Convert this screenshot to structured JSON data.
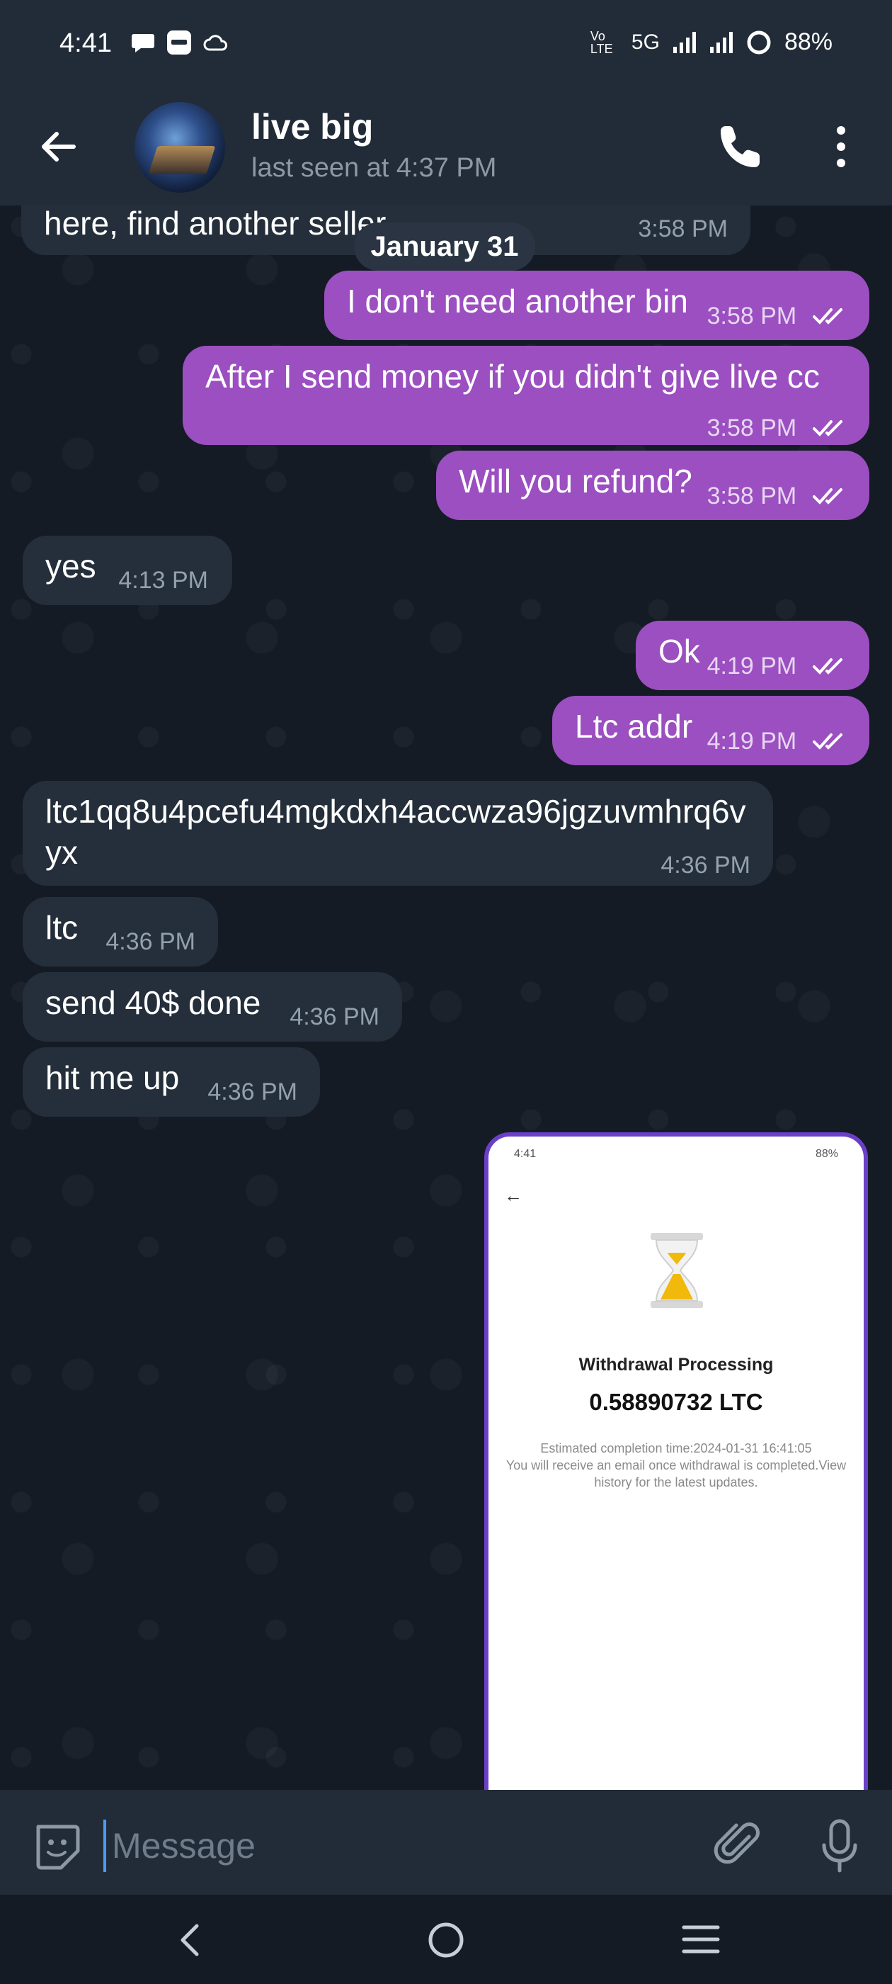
{
  "status_bar": {
    "time": "4:41",
    "network": "5G",
    "volte": "Vo LTE",
    "battery": "88%"
  },
  "header": {
    "name": "live big",
    "last_seen": "last seen at 4:37 PM"
  },
  "date_separator": "January 31",
  "messages": [
    {
      "dir": "in",
      "text": "here, find another seller",
      "time": "3:58 PM"
    },
    {
      "dir": "out",
      "text": "I don't need another bin",
      "time": "3:58 PM"
    },
    {
      "dir": "out",
      "text": "After I send money if you didn't give live cc",
      "time": "3:58 PM"
    },
    {
      "dir": "out",
      "text": "Will you refund?",
      "time": "3:58 PM"
    },
    {
      "dir": "in",
      "text": "yes",
      "time": "4:13 PM"
    },
    {
      "dir": "out",
      "text": "Ok",
      "time": "4:19 PM"
    },
    {
      "dir": "out",
      "text": "Ltc addr",
      "time": "4:19 PM"
    },
    {
      "dir": "in",
      "text": "ltc1qq8u4pcefu4mgkdxh4accwza96jgzuvmhrq6vyx",
      "time": "4:36 PM"
    },
    {
      "dir": "in",
      "text": "ltc",
      "time": "4:36 PM"
    },
    {
      "dir": "in",
      "text": "send 40$ done",
      "time": "4:36 PM"
    },
    {
      "dir": "in",
      "text": "hit me up",
      "time": "4:36 PM"
    }
  ],
  "screenshot_message": {
    "status_time": "4:41",
    "status_battery": "88%",
    "title": "Withdrawal Processing",
    "amount": "0.58890732 LTC",
    "line1": "Estimated completion time:2024-01-31 16:41:05",
    "line2": "You will receive an email once withdrawal is completed.View history for the latest updates."
  },
  "composer": {
    "placeholder": "Message"
  },
  "colors": {
    "outgoing_bubble": "#9b4fc0",
    "incoming_bubble": "#252f3b",
    "background": "#141b25",
    "header": "#222c38"
  }
}
